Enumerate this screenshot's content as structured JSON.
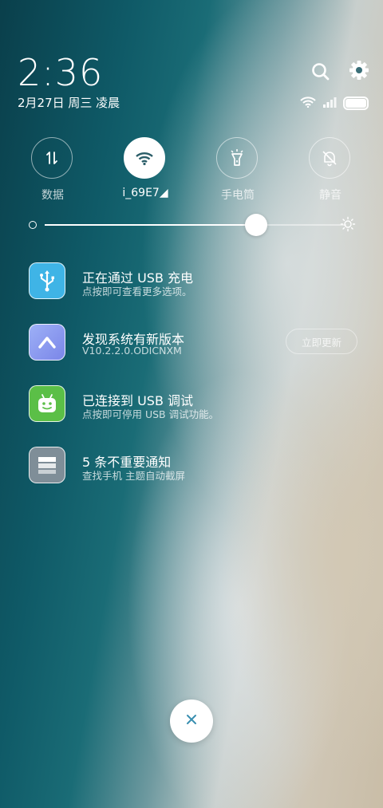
{
  "header": {
    "time": "2:36",
    "date": "2月27日 周三 凌晨"
  },
  "status_bar": {
    "icons": [
      "wifi-icon",
      "signal-icon",
      "battery-icon"
    ],
    "battery_level": 1.0
  },
  "quick_toggles": [
    {
      "label": "数据",
      "icon": "data-arrows-icon",
      "active": false
    },
    {
      "label": "i_69E7◢",
      "icon": "wifi-icon",
      "active": true
    },
    {
      "label": "手电筒",
      "icon": "flashlight-icon",
      "active": false
    },
    {
      "label": "静音",
      "icon": "bell-off-icon",
      "active": false
    }
  ],
  "brightness": {
    "level": 0.7
  },
  "notifications": [
    {
      "title": "正在通过 USB 充电",
      "subtitle": "点按即可查看更多选项。",
      "icon": "usb-icon",
      "color": "#3fb4e6"
    },
    {
      "title": "发现系统有新版本",
      "subtitle": "V10.2.2.0.ODICNXM",
      "icon": "update-icon",
      "color": "#8d9df0",
      "action": "立即更新"
    },
    {
      "title": "已连接到 USB 调试",
      "subtitle": "点按即可停用 USB 调试功能。",
      "icon": "android-icon",
      "color": "#5bbf47"
    },
    {
      "title": "5 条不重要通知",
      "subtitle": "查找手机 主题自动截屏",
      "icon": "folded-notifications-icon",
      "color": "#7f8e98"
    }
  ],
  "colors": {
    "accent_white": "#ffffff",
    "close_icon": "#3a8fb0"
  }
}
